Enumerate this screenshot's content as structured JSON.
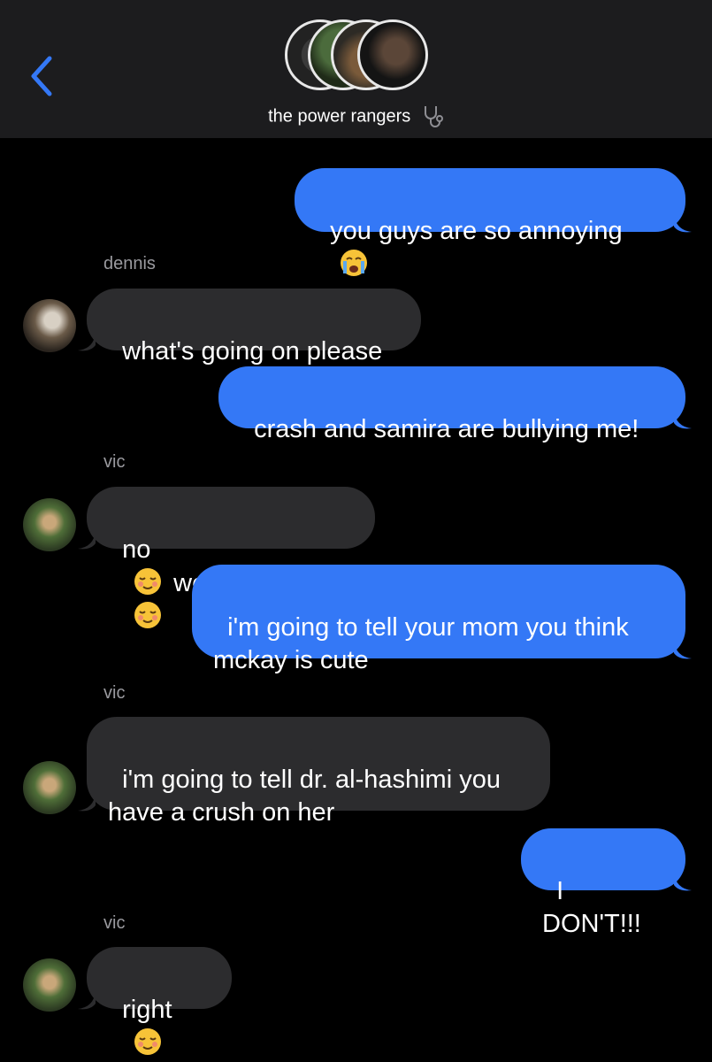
{
  "header": {
    "title": "the power rangers",
    "title_icon": "stethoscope-icon",
    "back_icon": "chevron-left-icon"
  },
  "messages": [
    {
      "from": "me",
      "text_parts": [
        "you guys are so annoying"
      ],
      "emojis": [
        "😭"
      ]
    },
    {
      "sender": "dennis",
      "text_parts": [
        "what's going on please"
      ]
    },
    {
      "from": "me",
      "text_parts": [
        "crash and samira are bullying me!"
      ]
    },
    {
      "sender": "vic",
      "text_parts": [
        "no",
        "we're not"
      ],
      "emojis": [
        "☺️",
        "☺️"
      ]
    },
    {
      "from": "me",
      "text_parts": [
        "i'm going to tell your mom you think\nmckay is cute"
      ]
    },
    {
      "sender": "vic",
      "text_parts": [
        "i'm going to tell dr. al-hashimi you\nhave a crush on her"
      ]
    },
    {
      "from": "me",
      "text_parts": [
        "I DON'T!!!"
      ]
    },
    {
      "sender": "vic",
      "text_parts": [
        "right"
      ],
      "emojis": [
        "☺️"
      ]
    }
  ],
  "colors": {
    "sent_bubble": "#3478f6",
    "received_bubble": "#2c2c2e",
    "header_bg": "#1c1c1e",
    "sender_label": "#9a9a9f"
  }
}
